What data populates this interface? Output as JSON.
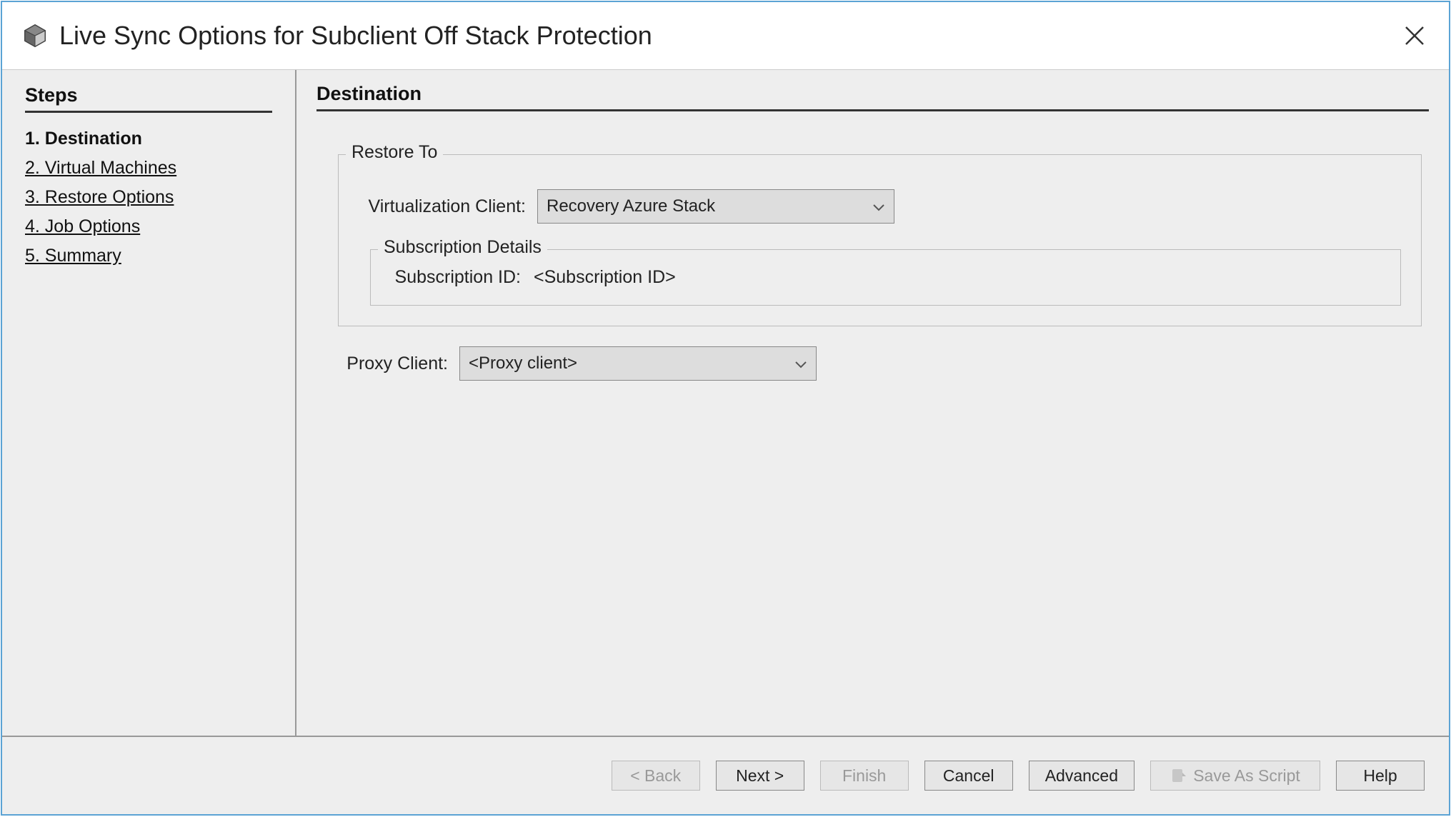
{
  "window": {
    "title": "Live Sync Options for Subclient Off Stack Protection"
  },
  "sidebar": {
    "heading": "Steps",
    "items": [
      {
        "label": "1. Destination",
        "current": true
      },
      {
        "label": "2. Virtual Machines",
        "current": false
      },
      {
        "label": "3. Restore Options",
        "current": false
      },
      {
        "label": "4. Job Options",
        "current": false
      },
      {
        "label": "5. Summary",
        "current": false
      }
    ]
  },
  "main": {
    "heading": "Destination",
    "restore_to": {
      "legend": "Restore To",
      "virt_client_label": "Virtualization Client:",
      "virt_client_value": "Recovery Azure Stack",
      "subscription_legend": "Subscription Details",
      "subscription_id_label": "Subscription ID:",
      "subscription_id_value": "<Subscription ID>"
    },
    "proxy": {
      "label": "Proxy Client:",
      "value": "<Proxy client>"
    }
  },
  "footer": {
    "back": "< Back",
    "next": "Next >",
    "finish": "Finish",
    "cancel": "Cancel",
    "advanced": "Advanced",
    "save_script": "Save As Script",
    "help": "Help"
  }
}
